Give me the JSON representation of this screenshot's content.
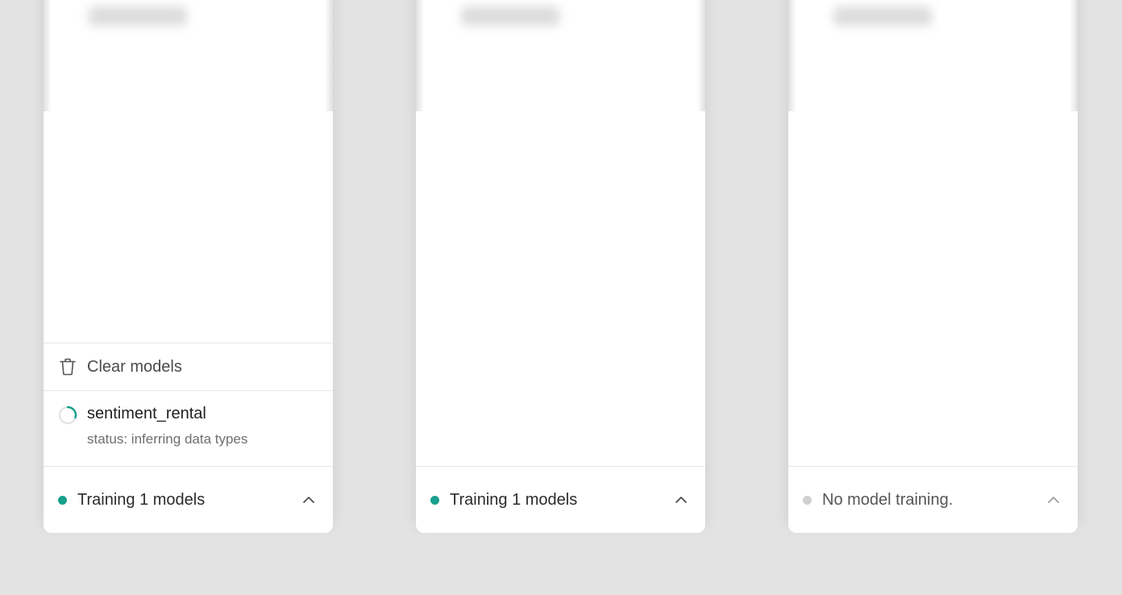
{
  "colors": {
    "active": "#17a08c",
    "inactive": "#cfcfcf",
    "background": "#e3e3e3"
  },
  "panels": [
    {
      "clear_label": "Clear models",
      "model": {
        "name": "sentiment_rental",
        "status": "status: inferring data types"
      },
      "footer": {
        "text": "Training 1 models",
        "state": "active"
      }
    },
    {
      "footer": {
        "text": "Training 1 models",
        "state": "active"
      }
    },
    {
      "footer": {
        "text": "No model training.",
        "state": "inactive"
      }
    }
  ]
}
